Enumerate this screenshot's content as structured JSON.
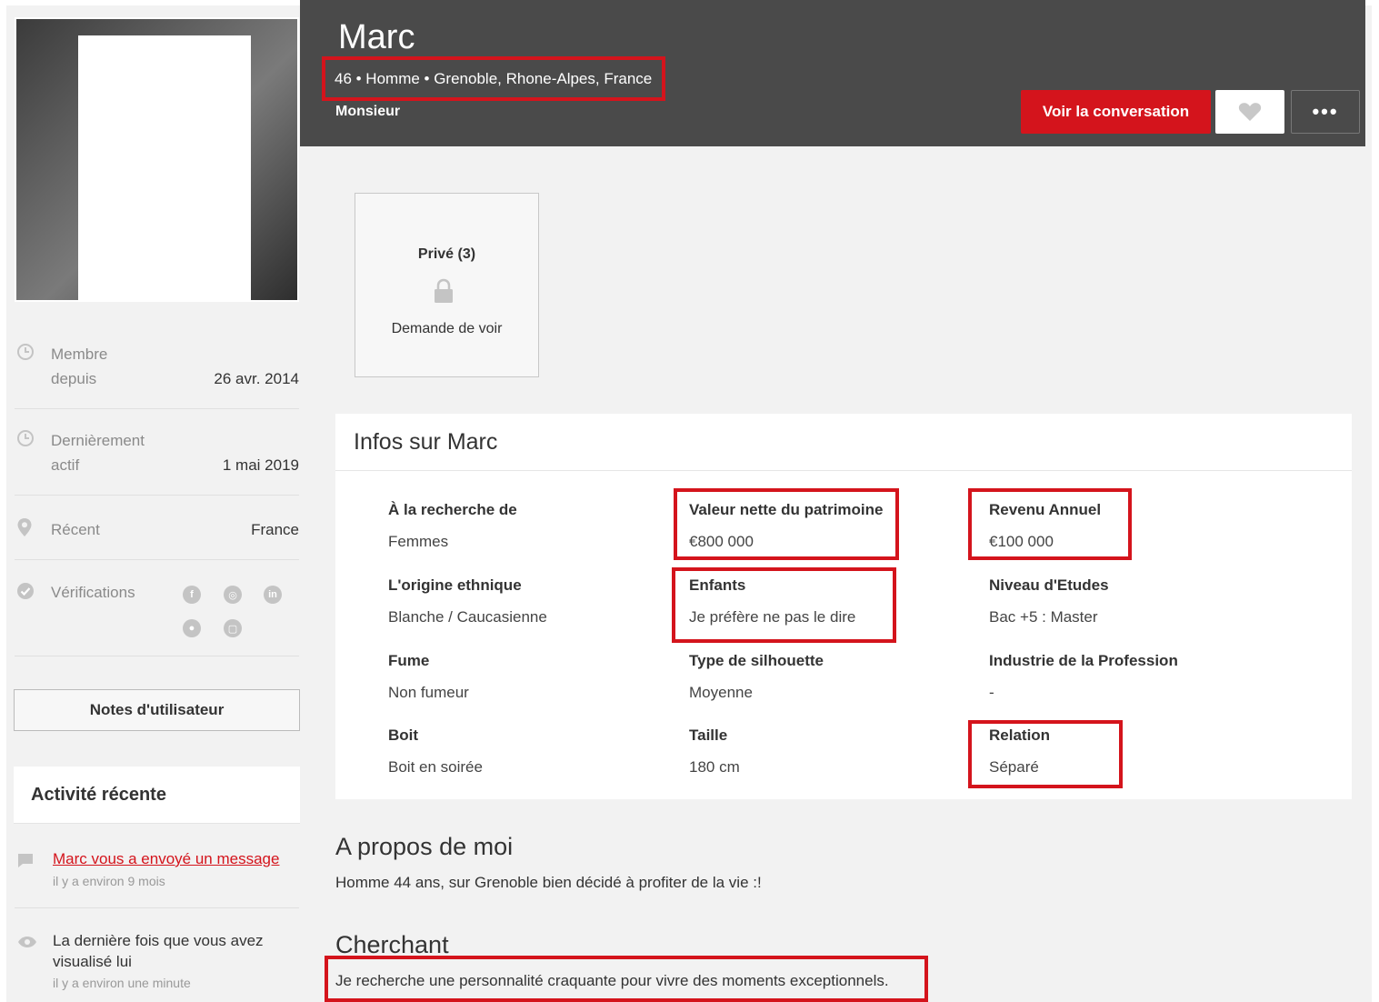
{
  "profile": {
    "name": "Marc",
    "meta": "46 • Homme • Grenoble, Rhone-Alpes, France",
    "tagline": "Monsieur"
  },
  "actions": {
    "conversation_label": "Voir la conversation",
    "more_label": "•••"
  },
  "sidebar": {
    "member_label_1": "Membre",
    "member_label_2": "depuis",
    "member_value": "26 avr. 2014",
    "active_label_1": "Dernièrement",
    "active_label_2": "actif",
    "active_value": "1 mai 2019",
    "recent_label": "Récent",
    "recent_value": "France",
    "verifications_label": "Vérifications",
    "notes_button": "Notes d'utilisateur"
  },
  "activity": {
    "title": "Activité récente",
    "item1_text": "Marc vous a envoyé un message",
    "item1_time": "il y a environ 9 mois",
    "item2_line1": "La dernière fois que vous avez",
    "item2_line2": "visualisé lui",
    "item2_time": "il y a environ une minute"
  },
  "private_photos": {
    "title": "Privé (3)",
    "request_label": "Demande de voir"
  },
  "info": {
    "title": "Infos sur Marc",
    "fields": [
      {
        "label": "À la recherche de",
        "value": "Femmes"
      },
      {
        "label": "Valeur nette du patrimoine",
        "value": "€800 000"
      },
      {
        "label": "Revenu Annuel",
        "value": "€100 000"
      },
      {
        "label": "L'origine ethnique",
        "value": "Blanche / Caucasienne"
      },
      {
        "label": "Enfants",
        "value": "Je préfère ne pas le dire"
      },
      {
        "label": "Niveau d'Etudes",
        "value": "Bac +5 : Master"
      },
      {
        "label": "Fume",
        "value": "Non fumeur"
      },
      {
        "label": "Type de silhouette",
        "value": "Moyenne"
      },
      {
        "label": "Industrie de la Profession",
        "value": "-"
      },
      {
        "label": "Boit",
        "value": "Boit en soirée"
      },
      {
        "label": "Taille",
        "value": "180 cm"
      },
      {
        "label": "Relation",
        "value": "Séparé"
      }
    ]
  },
  "about": {
    "title": "A propos de moi",
    "text": "Homme 44 ans, sur Grenoble bien décidé à profiter de la vie :!"
  },
  "seeking": {
    "title": "Cherchant",
    "text": "Je recherche une personnalité craquante pour vivre des moments exceptionnels."
  },
  "colors": {
    "accent": "#d4141c",
    "header_bg": "#4a4a4a",
    "page_bg": "#f2f2f2"
  }
}
